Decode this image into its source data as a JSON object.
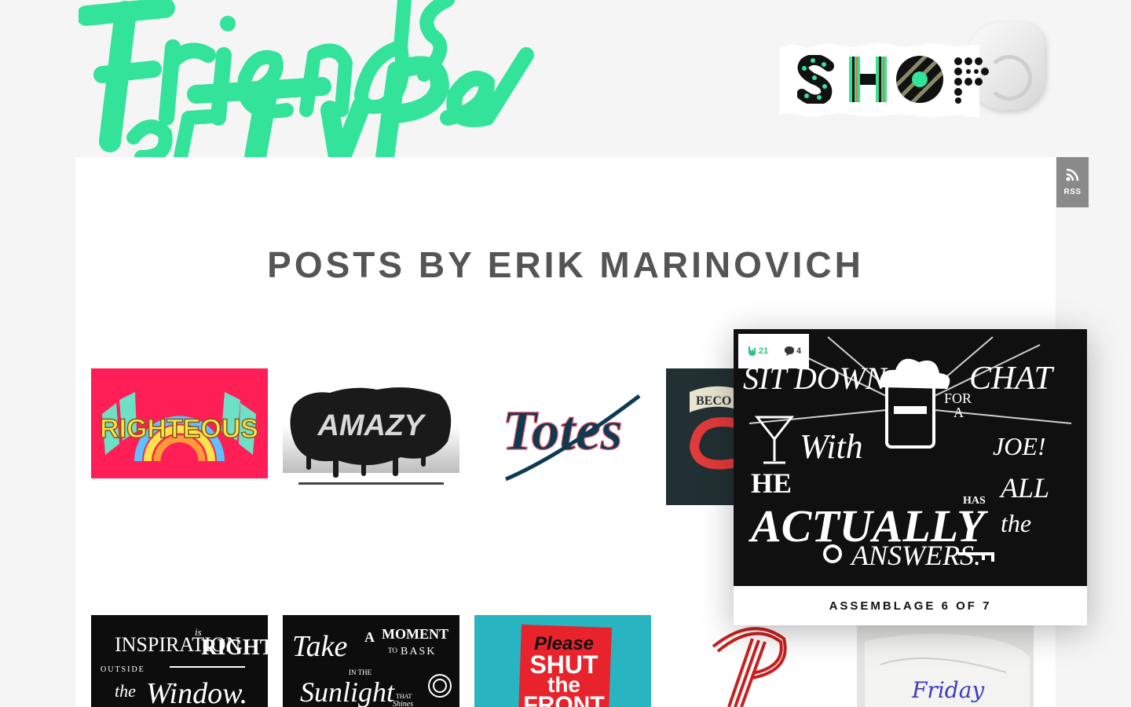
{
  "site": {
    "logo_text": "Friends of Type",
    "accent_color": "#33e39a",
    "shop": {
      "label": "SHOP"
    },
    "rss": {
      "label": "RSS"
    }
  },
  "page": {
    "title": "POSTS BY ERIK MARINOVICH"
  },
  "posts_row1": [
    {
      "art_text": "RIGHTEOUS",
      "bg": "#ff1e55"
    },
    {
      "art_text": "AMAZY"
    },
    {
      "art_text": "Totes"
    },
    {
      "art_text": "BECO",
      "bg": "#233033"
    }
  ],
  "posts_row2": [
    {
      "art_lines": [
        "INSPIRATION",
        "is",
        "RIGHT",
        "OUTSIDE",
        "the",
        "Window."
      ]
    },
    {
      "art_lines": [
        "Take",
        "A",
        "MOMENT",
        "TO",
        "BASK",
        "IN THE",
        "Sunlight",
        "THAT",
        "Shines"
      ]
    },
    {
      "art_lines": [
        "Please",
        "SHUT",
        "the",
        "FRONT"
      ]
    },
    {
      "art_text": "P"
    },
    {
      "art_text": "Friday"
    }
  ],
  "hover": {
    "likes": "21",
    "comments": "4",
    "art_lines": [
      "SIT DOWN",
      "FOR",
      "A",
      "CHAT",
      "With",
      "JOE!",
      "HE",
      "ACTUALLY",
      "HAS",
      "ALL",
      "the",
      "ANSWERS."
    ],
    "caption": "ASSEMBLAGE 6 OF 7"
  },
  "colors": {
    "title": "#555555",
    "rss_bg": "#8a8a8a",
    "like_green": "#2ec27e"
  }
}
